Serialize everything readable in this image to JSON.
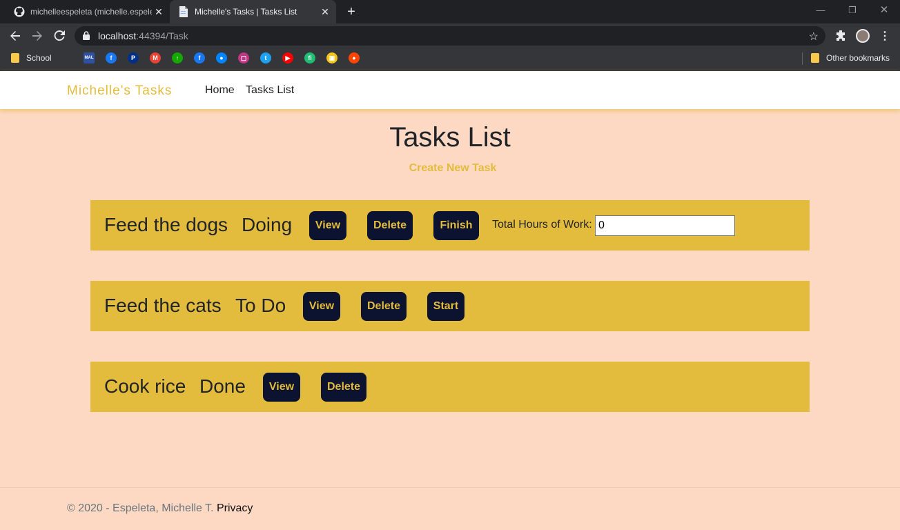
{
  "browser": {
    "tabs": [
      {
        "title": "michelleespeleta (michelle.espele",
        "favicon": "github-icon",
        "active": false
      },
      {
        "title": "Michelle's Tasks | Tasks List",
        "favicon": "page-icon",
        "active": true
      }
    ],
    "url_host": "localhost",
    "url_path": ":44394/Task",
    "bookmarks": {
      "school": "School",
      "other": "Other bookmarks",
      "icons": [
        {
          "name": "mal-icon",
          "text": "MAL",
          "color": "#2e51a2"
        },
        {
          "name": "facebook-icon",
          "text": "f",
          "color": "#1877f2"
        },
        {
          "name": "paypal-icon",
          "text": "P",
          "color": "#003087"
        },
        {
          "name": "gmail-icon",
          "text": "M",
          "color": "#ea4335"
        },
        {
          "name": "upwork-icon",
          "text": "↑",
          "color": "#14a800"
        },
        {
          "name": "facebook-icon",
          "text": "f",
          "color": "#1877f2"
        },
        {
          "name": "messenger-icon",
          "text": "●",
          "color": "#0084ff"
        },
        {
          "name": "instagram-icon",
          "text": "▢",
          "color": "#c13584"
        },
        {
          "name": "twitter-icon",
          "text": "t",
          "color": "#1da1f2"
        },
        {
          "name": "youtube-icon",
          "text": "▶",
          "color": "#ff0000"
        },
        {
          "name": "fiverr-icon",
          "text": "fi",
          "color": "#1dbf73"
        },
        {
          "name": "notes-icon",
          "text": "▣",
          "color": "#f5c518"
        },
        {
          "name": "reddit-icon",
          "text": "●",
          "color": "#ff4500"
        }
      ]
    }
  },
  "site": {
    "brand": "Michelle's Tasks",
    "nav": {
      "home": "Home",
      "tasks": "Tasks List"
    }
  },
  "main": {
    "title": "Tasks List",
    "create_link": "Create New Task",
    "tasks": [
      {
        "name": "Feed the dogs",
        "status": "Doing",
        "view": "View",
        "delete": "Delete",
        "action": "Finish",
        "hours_label": "Total Hours of Work:",
        "hours_value": "0"
      },
      {
        "name": "Feed the cats",
        "status": "To Do",
        "view": "View",
        "delete": "Delete",
        "action": "Start"
      },
      {
        "name": "Cook rice",
        "status": "Done",
        "view": "View",
        "delete": "Delete"
      }
    ]
  },
  "footer": {
    "text": "© 2020 - Espeleta, Michelle T.",
    "privacy": "Privacy"
  },
  "colors": {
    "background": "#fdd9c3",
    "accent": "#e3bb3d",
    "button": "#0b1330"
  }
}
